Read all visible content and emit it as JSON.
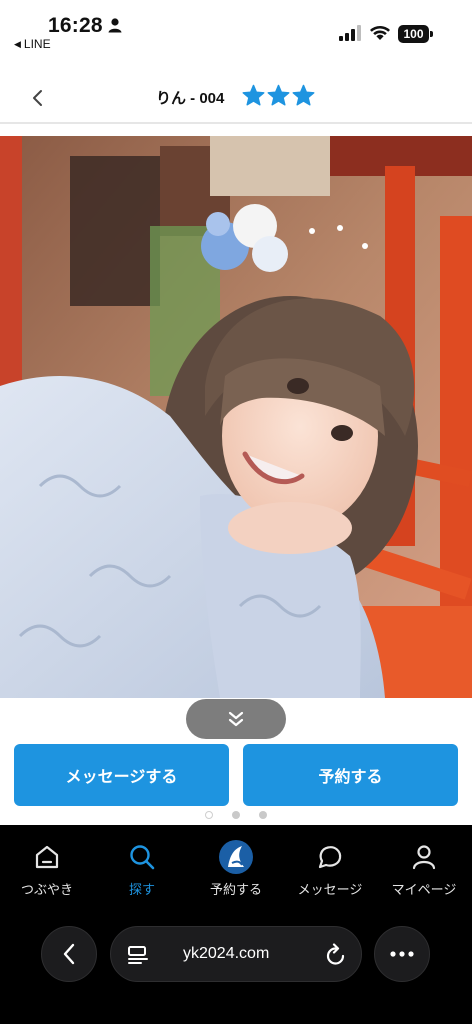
{
  "status_bar": {
    "time": "16:28",
    "back_app": "LINE",
    "battery": "100"
  },
  "header": {
    "title": "りん - 004",
    "rating": 3
  },
  "photo": {
    "alt": "woman in light blue kimono with hair ornament"
  },
  "actions": {
    "message_label": "メッセージする",
    "reserve_label": "予約する"
  },
  "carousel": {
    "total": 3,
    "active": 1
  },
  "nav": {
    "items": [
      {
        "label": "つぶやき",
        "icon": "home-icon"
      },
      {
        "label": "探す",
        "icon": "search-icon"
      },
      {
        "label": "予約する",
        "icon": "logo-icon"
      },
      {
        "label": "メッセージ",
        "icon": "chat-icon"
      },
      {
        "label": "マイページ",
        "icon": "person-icon"
      }
    ],
    "active_index": 1
  },
  "browser": {
    "url": "yk2024.com"
  },
  "colors": {
    "accent": "#1e94e0",
    "nav_bg": "#000000"
  }
}
